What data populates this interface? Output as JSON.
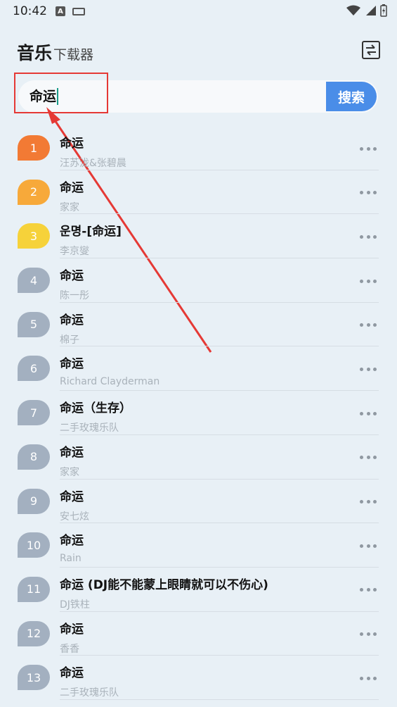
{
  "status_bar": {
    "time": "10:42",
    "notif_a": "A"
  },
  "header": {
    "title_main": "音乐",
    "title_sub": "下载器"
  },
  "search": {
    "value": "命运",
    "button_label": "搜索"
  },
  "colors": {
    "rank1": "#f27a34",
    "rank2": "#f7a93a",
    "rank3": "#f6d23a",
    "rank_default": "#a3b0c0",
    "accent": "#4a8de8",
    "annotation": "#e53935"
  },
  "results": [
    {
      "rank": "1",
      "title": "命运",
      "artist": "汪苏泷&张碧晨"
    },
    {
      "rank": "2",
      "title": "命运",
      "artist": "家家"
    },
    {
      "rank": "3",
      "title": "운명-[命运]",
      "artist": "李京燮"
    },
    {
      "rank": "4",
      "title": "命运",
      "artist": "陈一彤"
    },
    {
      "rank": "5",
      "title": "命运",
      "artist": "棉子"
    },
    {
      "rank": "6",
      "title": "命运",
      "artist": "Richard Clayderman"
    },
    {
      "rank": "7",
      "title": "命运（生存）",
      "artist": "二手玫瑰乐队"
    },
    {
      "rank": "8",
      "title": "命运",
      "artist": "家家"
    },
    {
      "rank": "9",
      "title": "命运",
      "artist": "安七炫"
    },
    {
      "rank": "10",
      "title": "命运",
      "artist": "Rain"
    },
    {
      "rank": "11",
      "title": "命运 (DJ能不能蒙上眼睛就可以不伤心)",
      "artist": "DJ铁柱"
    },
    {
      "rank": "12",
      "title": "命运",
      "artist": "香香"
    },
    {
      "rank": "13",
      "title": "命运",
      "artist": "二手玫瑰乐队"
    }
  ]
}
